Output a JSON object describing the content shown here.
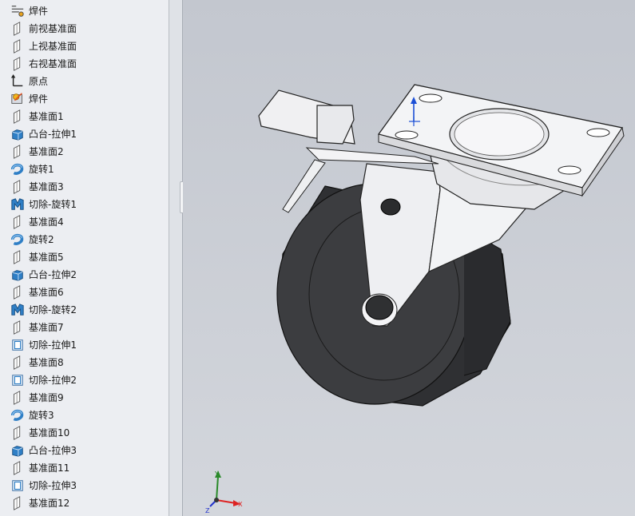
{
  "feature_tree": {
    "items": [
      {
        "label": "焊件",
        "icon": "weldment-folder-icon"
      },
      {
        "label": "前视基准面",
        "icon": "plane-icon"
      },
      {
        "label": "上视基准面",
        "icon": "plane-icon"
      },
      {
        "label": "右视基准面",
        "icon": "plane-icon"
      },
      {
        "label": "原点",
        "icon": "origin-icon"
      },
      {
        "label": "焊件",
        "icon": "weldment-icon"
      },
      {
        "label": "基准面1",
        "icon": "plane-icon"
      },
      {
        "label": "凸台-拉伸1",
        "icon": "boss-extrude-icon"
      },
      {
        "label": "基准面2",
        "icon": "plane-icon"
      },
      {
        "label": "旋转1",
        "icon": "revolve-icon"
      },
      {
        "label": "基准面3",
        "icon": "plane-icon"
      },
      {
        "label": "切除-旋转1",
        "icon": "cut-revolve-icon"
      },
      {
        "label": "基准面4",
        "icon": "plane-icon"
      },
      {
        "label": "旋转2",
        "icon": "revolve-icon"
      },
      {
        "label": "基准面5",
        "icon": "plane-icon"
      },
      {
        "label": "凸台-拉伸2",
        "icon": "boss-extrude-icon"
      },
      {
        "label": "基准面6",
        "icon": "plane-icon"
      },
      {
        "label": "切除-旋转2",
        "icon": "cut-revolve-icon"
      },
      {
        "label": "基准面7",
        "icon": "plane-icon"
      },
      {
        "label": "切除-拉伸1",
        "icon": "cut-extrude-icon"
      },
      {
        "label": "基准面8",
        "icon": "plane-icon"
      },
      {
        "label": "切除-拉伸2",
        "icon": "cut-extrude-icon"
      },
      {
        "label": "基准面9",
        "icon": "plane-icon"
      },
      {
        "label": "旋转3",
        "icon": "revolve-icon"
      },
      {
        "label": "基准面10",
        "icon": "plane-icon"
      },
      {
        "label": "凸台-拉伸3",
        "icon": "boss-extrude-icon"
      },
      {
        "label": "基准面11",
        "icon": "plane-icon"
      },
      {
        "label": "切除-拉伸3",
        "icon": "cut-extrude-icon"
      },
      {
        "label": "基准面12",
        "icon": "plane-icon"
      }
    ]
  },
  "triad": {
    "x_label": "X",
    "y_label": "Y",
    "z_label": "Z"
  },
  "colors": {
    "tree_bg": "#eceef2",
    "viewport_top": "#c3c7cf",
    "viewport_bottom": "#d3d6dc",
    "wheel": "#3a3b3e",
    "metal": "#e9eaee",
    "feature_blue": "#2f7fc6"
  }
}
